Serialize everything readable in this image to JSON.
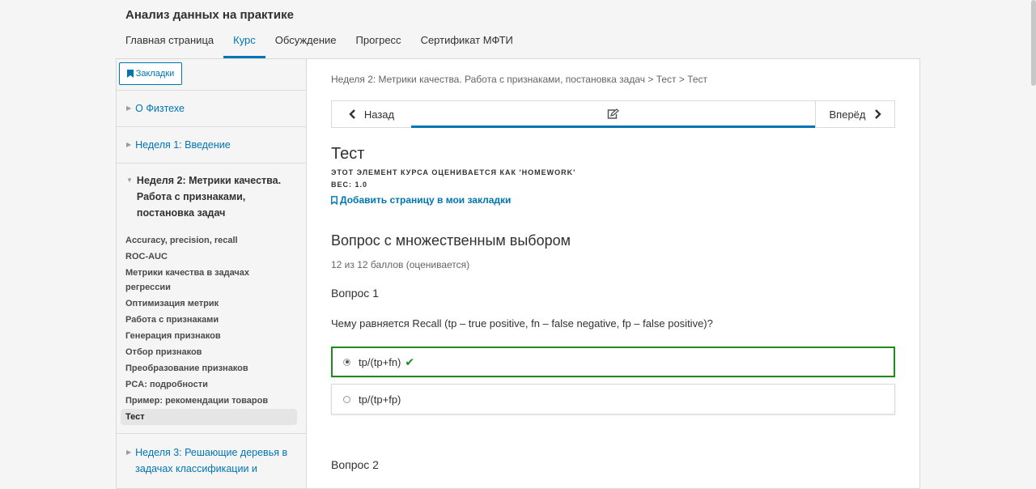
{
  "course": {
    "title": "Анализ данных на практике"
  },
  "tabs": [
    {
      "label": "Главная страница",
      "active": false
    },
    {
      "label": "Курс",
      "active": true
    },
    {
      "label": "Обсуждение",
      "active": false
    },
    {
      "label": "Прогресс",
      "active": false
    },
    {
      "label": "Сертификат МФТИ",
      "active": false
    }
  ],
  "sidebar": {
    "bookmarks_label": "Закладки",
    "chapters": [
      {
        "label": "О Физтехе",
        "open": false
      },
      {
        "label": "Неделя 1: Введение",
        "open": false
      },
      {
        "label": "Неделя 2: Метрики качества. Работа с признаками, постановка задач",
        "open": true
      },
      {
        "label": "Неделя 3: Решающие деревья в задачах классификации и",
        "open": false
      }
    ],
    "subsections": [
      {
        "label": "Accuracy, precision, recall",
        "active": false
      },
      {
        "label": "ROC-AUC",
        "active": false
      },
      {
        "label": "Метрики качества в задачах регрессии",
        "active": false
      },
      {
        "label": "Оптимизация метрик",
        "active": false
      },
      {
        "label": "Работа с признаками",
        "active": false
      },
      {
        "label": "Генерация признаков",
        "active": false
      },
      {
        "label": "Отбор признаков",
        "active": false
      },
      {
        "label": "Преобразование признаков",
        "active": false
      },
      {
        "label": "PCA: подробности",
        "active": false
      },
      {
        "label": "Пример: рекомендации товаров",
        "active": false
      },
      {
        "label": "Тест",
        "active": true
      }
    ]
  },
  "content": {
    "breadcrumb": "Неделя 2: Метрики качества. Работа с признаками, постановка задач > Тест > Тест",
    "nav": {
      "prev_label": "Назад",
      "next_label": "Вперёд"
    },
    "unit_title": "Тест",
    "graded_note": "ЭТОТ ЭЛЕМЕНТ КУРСА ОЦЕНИВАЕТСЯ КАК 'HOMEWORK'",
    "weight_note": "ВЕС: 1.0",
    "add_bookmark_label": "Добавить страницу в мои закладки",
    "problem_header": "Вопрос с множественным выбором",
    "score": "12 из 12 баллов (оценивается)",
    "question1_label": "Вопрос 1",
    "question1_text": "Чему равняется Recall (tp – true positive, fn – false negative, fp – false positive)?",
    "choices": [
      {
        "label": "tp/(tp+fn)",
        "selected": true,
        "correct": true
      },
      {
        "label": "tp/(tp+fp)",
        "selected": false,
        "correct": false
      }
    ],
    "question2_label": "Вопрос 2"
  },
  "colors": {
    "accent": "#0075b4",
    "correct": "#1f8a1f",
    "page_bg": "#f5f5f5"
  },
  "icons": [
    "bookmark-icon",
    "bookmark-outline-icon",
    "chevron-left-icon",
    "chevron-right-icon",
    "edit-icon",
    "checkmark-icon",
    "triangle-right-icon",
    "triangle-down-icon"
  ]
}
